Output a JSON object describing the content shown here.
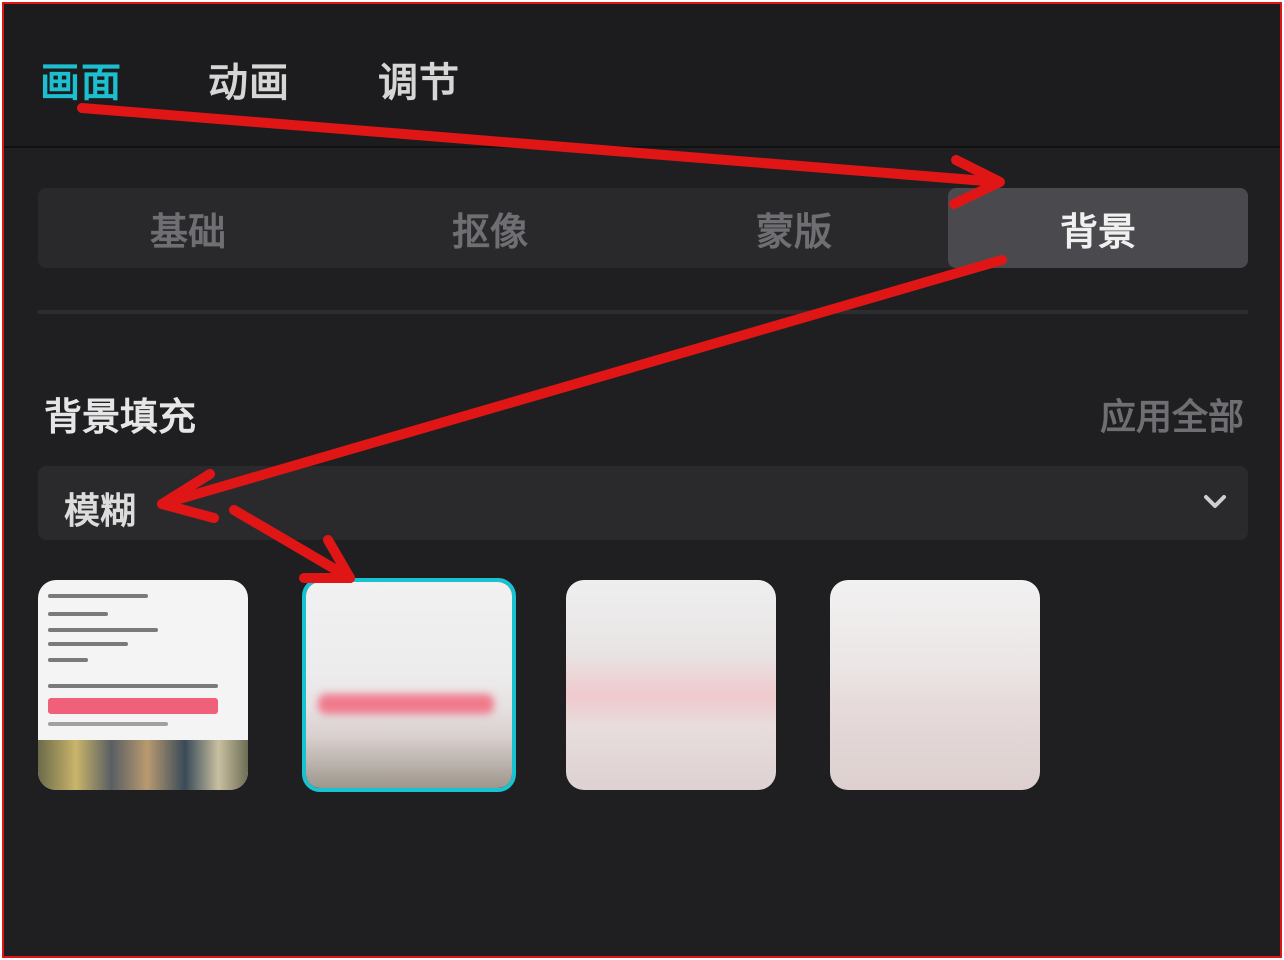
{
  "top_tabs": [
    {
      "label": "画面"
    },
    {
      "label": "动画"
    },
    {
      "label": "调节"
    }
  ],
  "segments": [
    {
      "label": "基础"
    },
    {
      "label": "抠像"
    },
    {
      "label": "蒙版"
    },
    {
      "label": "背景"
    }
  ],
  "background_fill": {
    "title": "背景填充",
    "apply_all": "应用全部",
    "dropdown_value": "模糊",
    "selected_thumbnail_index": 1
  },
  "colors": {
    "accent": "#1bbfcf",
    "annotation_arrow": "#e01616",
    "panel_bg": "#1f1f21"
  },
  "icons": {
    "dropdown": "chevron-down-icon"
  }
}
